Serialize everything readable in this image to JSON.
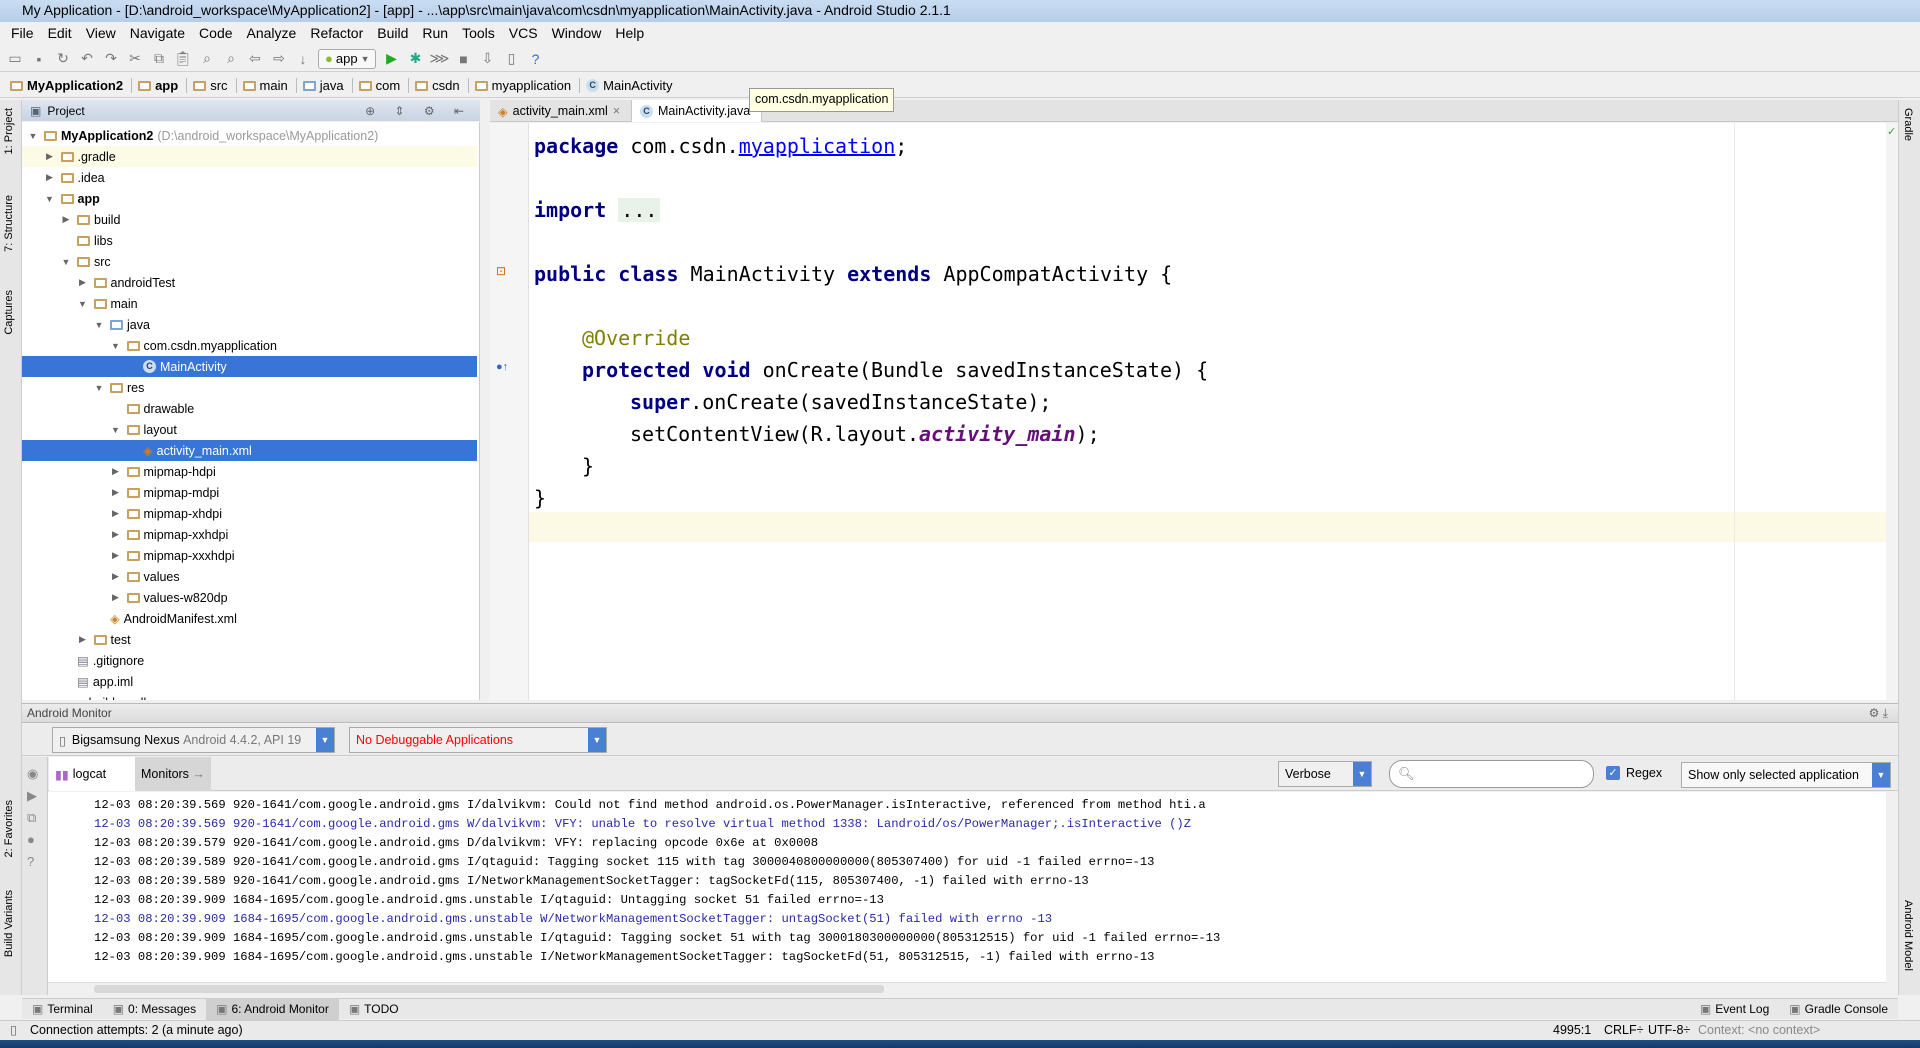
{
  "window": {
    "title": "My Application - [D:\\android_workspace\\MyApplication2] - [app] - ...\\app\\src\\main\\java\\com\\csdn\\myapplication\\MainActivity.java - Android Studio 2.1.1"
  },
  "menu": [
    "File",
    "Edit",
    "View",
    "Navigate",
    "Code",
    "Analyze",
    "Refactor",
    "Build",
    "Run",
    "Tools",
    "VCS",
    "Window",
    "Help"
  ],
  "toolbar": {
    "run_config": "app",
    "icons": [
      "open-icon",
      "save-icon",
      "sync-icon",
      "undo-icon",
      "redo-icon",
      "cut-icon",
      "copy-icon",
      "paste-icon",
      "find-icon",
      "replace-icon",
      "back-icon",
      "forward-icon",
      "make-icon",
      "run-icon",
      "debug-icon",
      "attach-icon",
      "stop-icon",
      "sdk-manager-icon",
      "avd-manager-icon",
      "help-icon"
    ]
  },
  "breadcrumb": [
    "MyApplication2",
    "app",
    "src",
    "main",
    "java",
    "com",
    "csdn",
    "myapplication",
    "MainActivity"
  ],
  "left_stripe": [
    "1: Project",
    "7: Structure",
    "Captures",
    "2: Favorites",
    "Build Variants"
  ],
  "right_stripe": [
    "Gradle",
    "Android Model"
  ],
  "project": {
    "header": "Project",
    "tree": [
      {
        "label": "MyApplication2",
        "extra": "(D:\\android_workspace\\MyApplication2)",
        "depth": 0,
        "state": "open",
        "icon": "module",
        "bold": true
      },
      {
        "label": ".gradle",
        "depth": 1,
        "state": "closed",
        "icon": "folder"
      },
      {
        "label": ".idea",
        "depth": 1,
        "state": "closed",
        "icon": "folder"
      },
      {
        "label": "app",
        "depth": 1,
        "state": "open",
        "icon": "module",
        "bold": true
      },
      {
        "label": "build",
        "depth": 2,
        "state": "closed",
        "icon": "folder"
      },
      {
        "label": "libs",
        "depth": 2,
        "state": "none",
        "icon": "folder"
      },
      {
        "label": "src",
        "depth": 2,
        "state": "open",
        "icon": "folder"
      },
      {
        "label": "androidTest",
        "depth": 3,
        "state": "closed",
        "icon": "folder"
      },
      {
        "label": "main",
        "depth": 3,
        "state": "open",
        "icon": "folder"
      },
      {
        "label": "java",
        "depth": 4,
        "state": "open",
        "icon": "folder-blue"
      },
      {
        "label": "com.csdn.myapplication",
        "depth": 5,
        "state": "open",
        "icon": "package"
      },
      {
        "label": "MainActivity",
        "depth": 6,
        "state": "none",
        "icon": "class",
        "selected": true
      },
      {
        "label": "res",
        "depth": 4,
        "state": "open",
        "icon": "folder"
      },
      {
        "label": "drawable",
        "depth": 5,
        "state": "none",
        "icon": "folder"
      },
      {
        "label": "layout",
        "depth": 5,
        "state": "open",
        "icon": "folder"
      },
      {
        "label": "activity_main.xml",
        "depth": 6,
        "state": "none",
        "icon": "xml",
        "selected": true
      },
      {
        "label": "mipmap-hdpi",
        "depth": 5,
        "state": "closed",
        "icon": "folder"
      },
      {
        "label": "mipmap-mdpi",
        "depth": 5,
        "state": "closed",
        "icon": "folder"
      },
      {
        "label": "mipmap-xhdpi",
        "depth": 5,
        "state": "closed",
        "icon": "folder"
      },
      {
        "label": "mipmap-xxhdpi",
        "depth": 5,
        "state": "closed",
        "icon": "folder"
      },
      {
        "label": "mipmap-xxxhdpi",
        "depth": 5,
        "state": "closed",
        "icon": "folder"
      },
      {
        "label": "values",
        "depth": 5,
        "state": "closed",
        "icon": "folder"
      },
      {
        "label": "values-w820dp",
        "depth": 5,
        "state": "closed",
        "icon": "folder"
      },
      {
        "label": "AndroidManifest.xml",
        "depth": 4,
        "state": "none",
        "icon": "manifest"
      },
      {
        "label": "test",
        "depth": 3,
        "state": "closed",
        "icon": "folder"
      },
      {
        "label": ".gitignore",
        "depth": 2,
        "state": "none",
        "icon": "file"
      },
      {
        "label": "app.iml",
        "depth": 2,
        "state": "none",
        "icon": "file"
      },
      {
        "label": "build.gradle",
        "depth": 2,
        "state": "none",
        "icon": "gradle"
      }
    ]
  },
  "editor": {
    "tabs": [
      {
        "label": "activity_main.xml",
        "active": false
      },
      {
        "label": "MainActivity.java",
        "active": true
      }
    ],
    "tooltip": "com.csdn.myapplication",
    "code": {
      "l1": {
        "kw": "package",
        "a": " com.csdn.",
        "link": "myapplication",
        "b": ";"
      },
      "l2": {
        "kw": "import",
        "dots": "..."
      },
      "l3": {
        "kw1": "public class",
        "a": " MainActivity ",
        "kw2": "extends",
        "b": " AppCompatActivity {"
      },
      "l4": {
        "ann": "@Override"
      },
      "l5": {
        "kw": "protected void",
        "a": " onCreate(Bundle savedInstanceState) {"
      },
      "l6": {
        "kw": "super",
        "a": ".onCreate(savedInstanceState);"
      },
      "l7": {
        "a": "setContentView(R.layout.",
        "fld": "activity_main",
        "b": ");"
      },
      "l8": "}",
      "l9": "}"
    }
  },
  "monitor": {
    "title": "Android Monitor",
    "device": {
      "name": "Bigsamsung Nexus",
      "info": "Android 4.4.2, API 19"
    },
    "process": "No Debuggable Applications",
    "tabs": [
      "logcat",
      "Monitors"
    ],
    "level": "Verbose",
    "search_placeholder": "",
    "regex_label": "Regex",
    "regex_checked": true,
    "filter": "Show only selected application",
    "logs": [
      {
        "text": "12-03 08:20:39.569 920-1641/com.google.android.gms I/dalvikvm: Could not find method android.os.PowerManager.isInteractive, referenced from method hti.a",
        "level": "I"
      },
      {
        "text": "12-03 08:20:39.569 920-1641/com.google.android.gms W/dalvikvm: VFY: unable to resolve virtual method 1338: Landroid/os/PowerManager;.isInteractive ()Z",
        "level": "W"
      },
      {
        "text": "12-03 08:20:39.579 920-1641/com.google.android.gms D/dalvikvm: VFY: replacing opcode 0x6e at 0x0008",
        "level": "D"
      },
      {
        "text": "12-03 08:20:39.589 920-1641/com.google.android.gms I/qtaguid: Tagging socket 115 with tag 3000040800000000(805307400) for uid -1 failed errno=-13",
        "level": "I"
      },
      {
        "text": "12-03 08:20:39.589 920-1641/com.google.android.gms I/NetworkManagementSocketTagger: tagSocketFd(115, 805307400, -1) failed with errno-13",
        "level": "I"
      },
      {
        "text": "12-03 08:20:39.909 1684-1695/com.google.android.gms.unstable I/qtaguid: Untagging socket 51 failed errno=-13",
        "level": "I"
      },
      {
        "text": "12-03 08:20:39.909 1684-1695/com.google.android.gms.unstable W/NetworkManagementSocketTagger: untagSocket(51) failed with errno -13",
        "level": "W"
      },
      {
        "text": "12-03 08:20:39.909 1684-1695/com.google.android.gms.unstable I/qtaguid: Tagging socket 51 with tag 3000180300000000(805312515) for uid -1 failed errno=-13",
        "level": "I"
      },
      {
        "text": "12-03 08:20:39.909 1684-1695/com.google.android.gms.unstable I/NetworkManagementSocketTagger: tagSocketFd(51, 805312515, -1) failed with errno-13",
        "level": "I"
      }
    ]
  },
  "tool_windows": {
    "left": [
      "Terminal",
      "0: Messages",
      "6: Android Monitor",
      "TODO"
    ],
    "right": [
      "Event Log",
      "Gradle Console"
    ],
    "active": "6: Android Monitor"
  },
  "status": {
    "message": "Connection attempts: 2 (a minute ago)",
    "position": "4995:1",
    "line_sep": "CRLF÷",
    "encoding": "UTF-8÷",
    "context": "Context: <no context>"
  },
  "colors": {
    "selection": "#3875d7",
    "keyword": "#000080",
    "annotation": "#808000",
    "warn_log": "#2929a8",
    "error_text": "#ff0000",
    "combo_button": "#4a7fd4"
  }
}
